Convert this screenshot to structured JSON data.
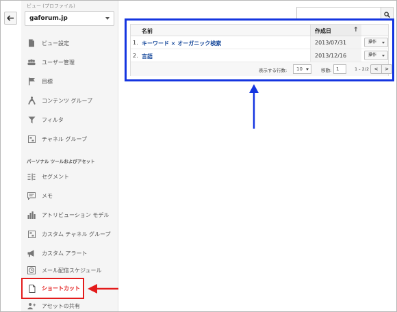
{
  "sidebar": {
    "view_label": "ビュー (プロファイル)",
    "view_value": "gaforum.jp",
    "items": [
      {
        "label": "ビュー設定",
        "icon": "document-icon"
      },
      {
        "label": "ユーザー管理",
        "icon": "users-icon"
      },
      {
        "label": "目標",
        "icon": "flag-icon"
      },
      {
        "label": "コンテンツ グループ",
        "icon": "person-walk-icon"
      },
      {
        "label": "フィルタ",
        "icon": "filter-icon"
      },
      {
        "label": "チャネル グループ",
        "icon": "channel-group-icon"
      }
    ],
    "section_title": "パーソナル ツールおよびアセット",
    "personal_items": [
      {
        "label": "セグメント",
        "icon": "segment-icon"
      },
      {
        "label": "メモ",
        "icon": "memo-icon"
      },
      {
        "label": "アトリビューション モデル",
        "icon": "bar-chart-icon"
      },
      {
        "label": "カスタム チャネル グループ",
        "icon": "channel-group-icon"
      },
      {
        "label": "カスタム アラート",
        "icon": "megaphone-icon"
      },
      {
        "label": "メール配信スケジュール",
        "icon": "clock-icon"
      },
      {
        "label": "ショートカット",
        "icon": "document-icon"
      },
      {
        "label": "アセットの共有",
        "icon": "add-user-icon"
      }
    ]
  },
  "table": {
    "columns": {
      "name": "名前",
      "created": "作成日"
    },
    "rows": [
      {
        "num": "1.",
        "name": "キーワード × オーガニック検索",
        "date": "2013/07/31",
        "action": "操作"
      },
      {
        "num": "2.",
        "name": "言語",
        "date": "2013/12/16",
        "action": "操作"
      }
    ],
    "footer": {
      "rows_label": "表示する行数:",
      "rows_value": "10",
      "goto_label": "移動:",
      "goto_value": "1",
      "range": "1 - 2/2",
      "prev": "<",
      "next": ">"
    }
  },
  "search": {
    "placeholder": ""
  },
  "colors": {
    "highlight_blue": "#1435e0",
    "highlight_red": "#e31b1b",
    "link": "#1a4b9c"
  }
}
